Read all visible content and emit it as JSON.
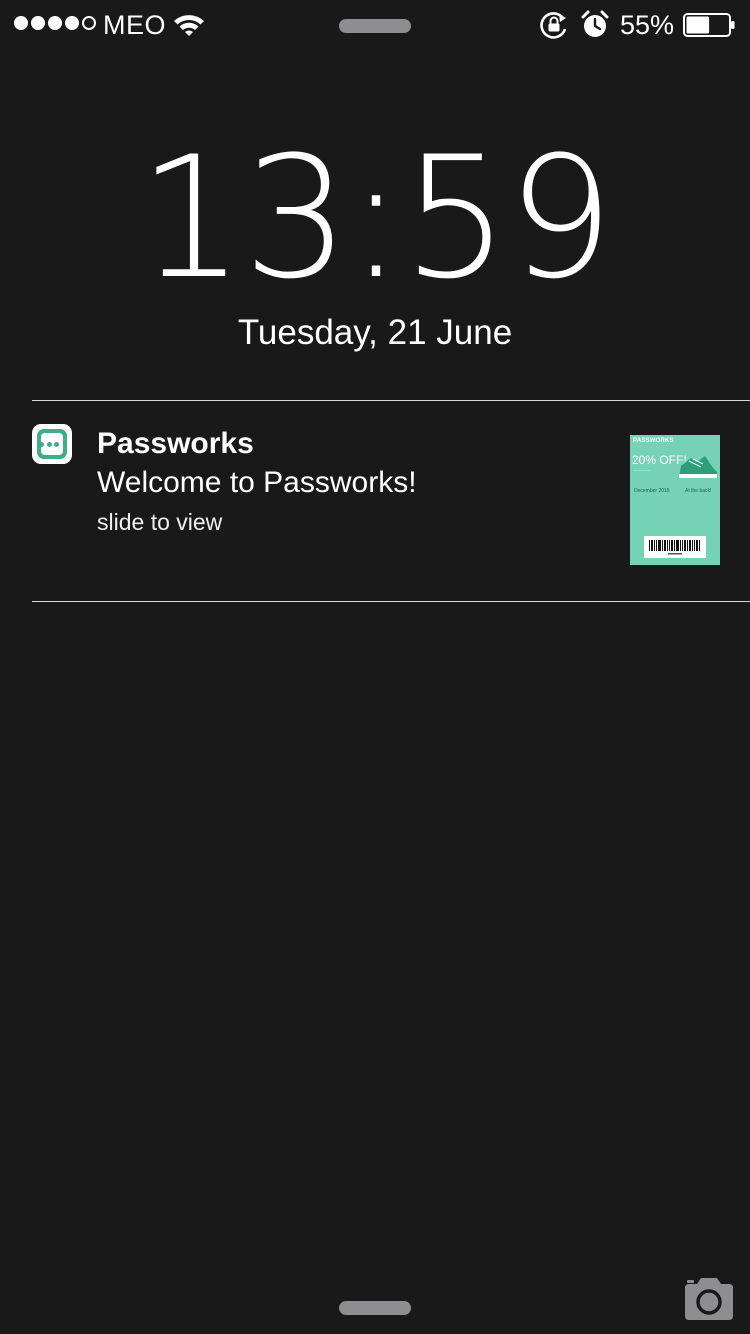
{
  "status_bar": {
    "signal_bars_filled": 4,
    "signal_bars_total": 5,
    "carrier": "MEO",
    "battery_percent": "55%",
    "battery_level": 0.55,
    "icons": [
      "wifi-icon",
      "rotation-lock-icon",
      "alarm-icon",
      "battery-icon"
    ]
  },
  "lock_screen": {
    "time": "13:59",
    "date": "Tuesday, 21 June"
  },
  "notification": {
    "app_name": "Passworks",
    "message": "Welcome to Passworks!",
    "action_hint": "slide to view",
    "icon": "passworks-app-icon",
    "accent_color": "#3fae88",
    "thumbnail": {
      "brand": "PASSWORKS",
      "offer": "20% OFF!",
      "date": "December 2015",
      "back_note": "At the back!",
      "background_color": "#76d2b5"
    }
  },
  "bottom": {
    "icons": [
      "camera-icon"
    ]
  }
}
